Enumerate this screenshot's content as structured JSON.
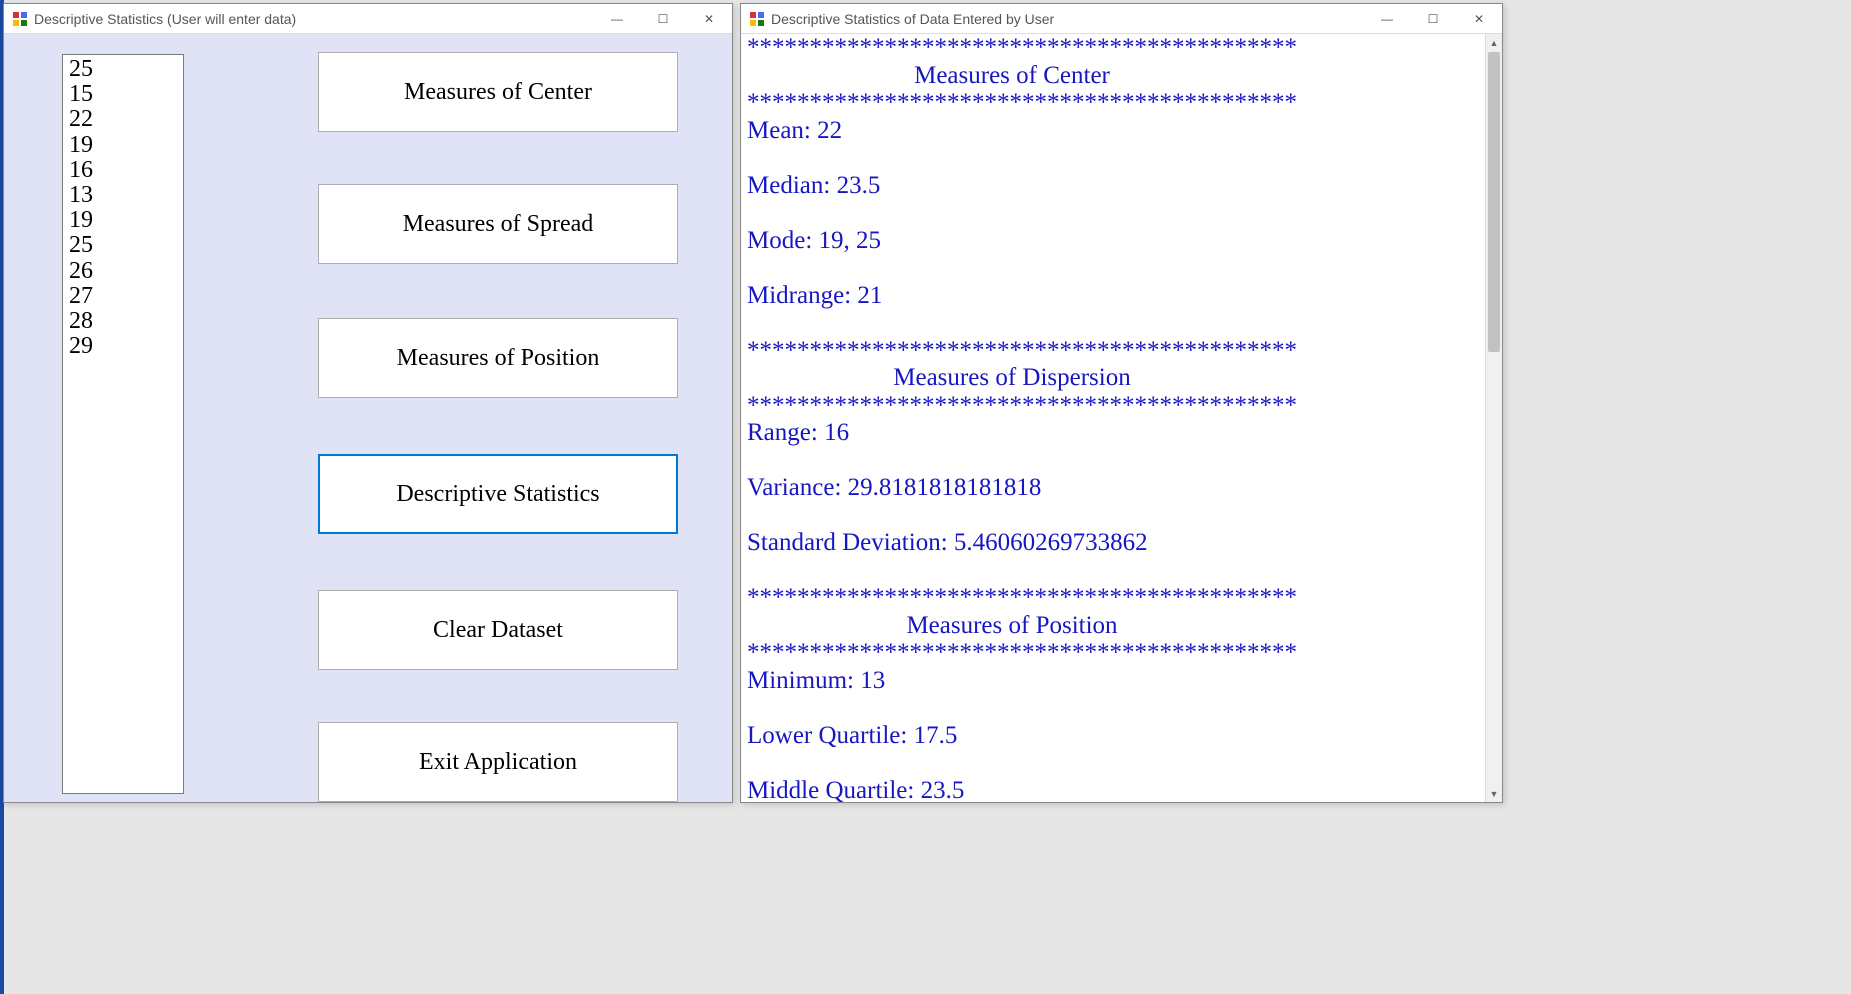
{
  "window_left": {
    "title": "Descriptive Statistics (User will enter data)",
    "controls": {
      "minimize": "—",
      "maximize": "☐",
      "close": "✕"
    }
  },
  "window_right": {
    "title": "Descriptive Statistics of Data Entered by User",
    "controls": {
      "minimize": "—",
      "maximize": "☐",
      "close": "✕"
    }
  },
  "dataset": [
    "25",
    "15",
    "22",
    "19",
    "16",
    "13",
    "19",
    "25",
    "26",
    "27",
    "28",
    "29"
  ],
  "buttons": {
    "measures_center": "Measures of Center",
    "measures_spread": "Measures of Spread",
    "measures_position": "Measures of Position",
    "descriptive_stats": "Descriptive Statistics",
    "clear_dataset": "Clear Dataset",
    "exit_app": "Exit Application"
  },
  "output": {
    "sep": "********************************************",
    "header_center": "Measures of Center",
    "mean": "Mean: 22",
    "median": "Median: 23.5",
    "mode": "Mode: 19, 25",
    "midrange": "Midrange: 21",
    "header_dispersion": "Measures of Dispersion",
    "range": "Range: 16",
    "variance": "Variance: 29.8181818181818",
    "stddev": "Standard Deviation: 5.46060269733862",
    "header_position": "Measures of Position",
    "minimum": "Minimum: 13",
    "lower_q": "Lower Quartile: 17.5",
    "middle_q_partial": "Middle Quartile: 23.5"
  }
}
